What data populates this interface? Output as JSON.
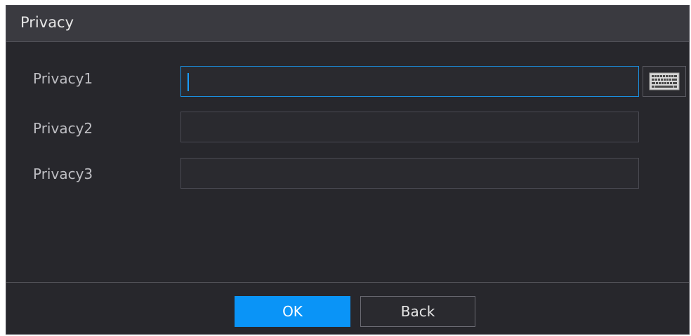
{
  "dialog": {
    "title": "Privacy",
    "fields": [
      {
        "label": "Privacy1",
        "value": "",
        "active": true
      },
      {
        "label": "Privacy2",
        "value": "",
        "active": false
      },
      {
        "label": "Privacy3",
        "value": "",
        "active": false
      }
    ],
    "buttons": {
      "ok_label": "OK",
      "back_label": "Back"
    }
  },
  "colors": {
    "background": "#27272c",
    "titlebar": "#3a3a40",
    "accent": "#0a94f7",
    "active_border": "#1a8fe0"
  },
  "icons": {
    "keyboard": "keyboard-icon"
  }
}
